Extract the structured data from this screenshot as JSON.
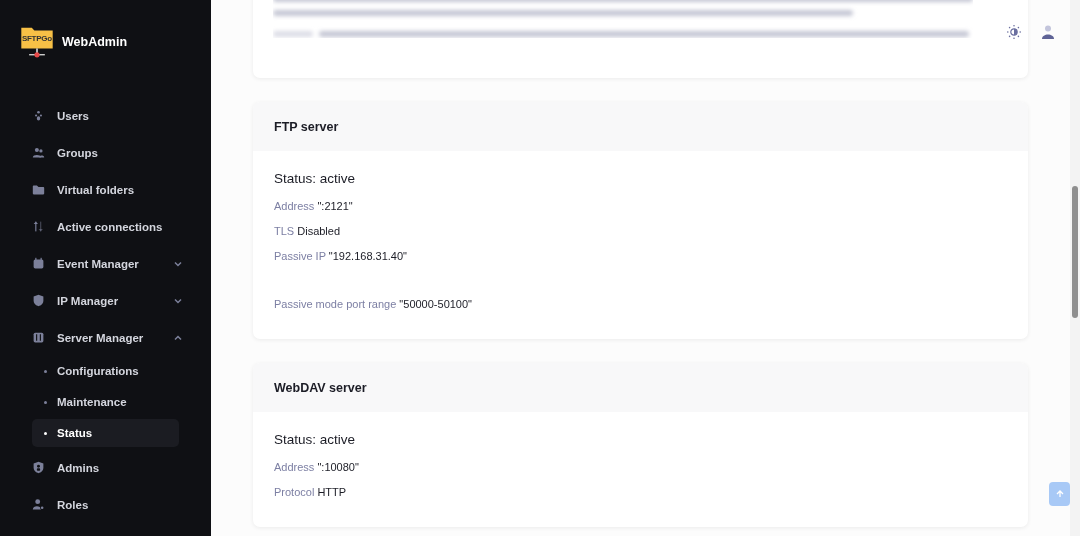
{
  "sidebar": {
    "logo_text": "SFTPGo",
    "brand": "WebAdmin",
    "items": [
      {
        "label": "Users",
        "selected": false
      },
      {
        "label": "Groups",
        "selected": false
      },
      {
        "label": "Virtual folders",
        "selected": false
      },
      {
        "label": "Active connections",
        "selected": false
      },
      {
        "label": "Event Manager",
        "selected": false,
        "expanded": false
      },
      {
        "label": "IP Manager",
        "selected": false,
        "expanded": false
      },
      {
        "label": "Server Manager",
        "selected": false,
        "expanded": true,
        "children": [
          {
            "label": "Configurations",
            "selected": false
          },
          {
            "label": "Maintenance",
            "selected": false
          },
          {
            "label": "Status",
            "selected": true
          }
        ]
      },
      {
        "label": "Admins",
        "selected": false
      },
      {
        "label": "Roles",
        "selected": false
      }
    ]
  },
  "cards": [
    {
      "title": "FTP server",
      "status": "Status: active",
      "field_groups": [
        [
          {
            "label": "Address",
            "value": "\":2121\""
          },
          {
            "label": "TLS",
            "value": "Disabled"
          },
          {
            "label": "Passive IP",
            "value": "\"192.168.31.40\""
          }
        ],
        [
          {
            "label": "Passive mode port range",
            "value": "\"50000-50100\""
          }
        ]
      ]
    },
    {
      "title": "WebDAV server",
      "status": "Status: active",
      "field_groups": [
        [
          {
            "label": "Address",
            "value": "\":10080\""
          },
          {
            "label": "Protocol",
            "value": "HTTP"
          }
        ]
      ]
    }
  ]
}
